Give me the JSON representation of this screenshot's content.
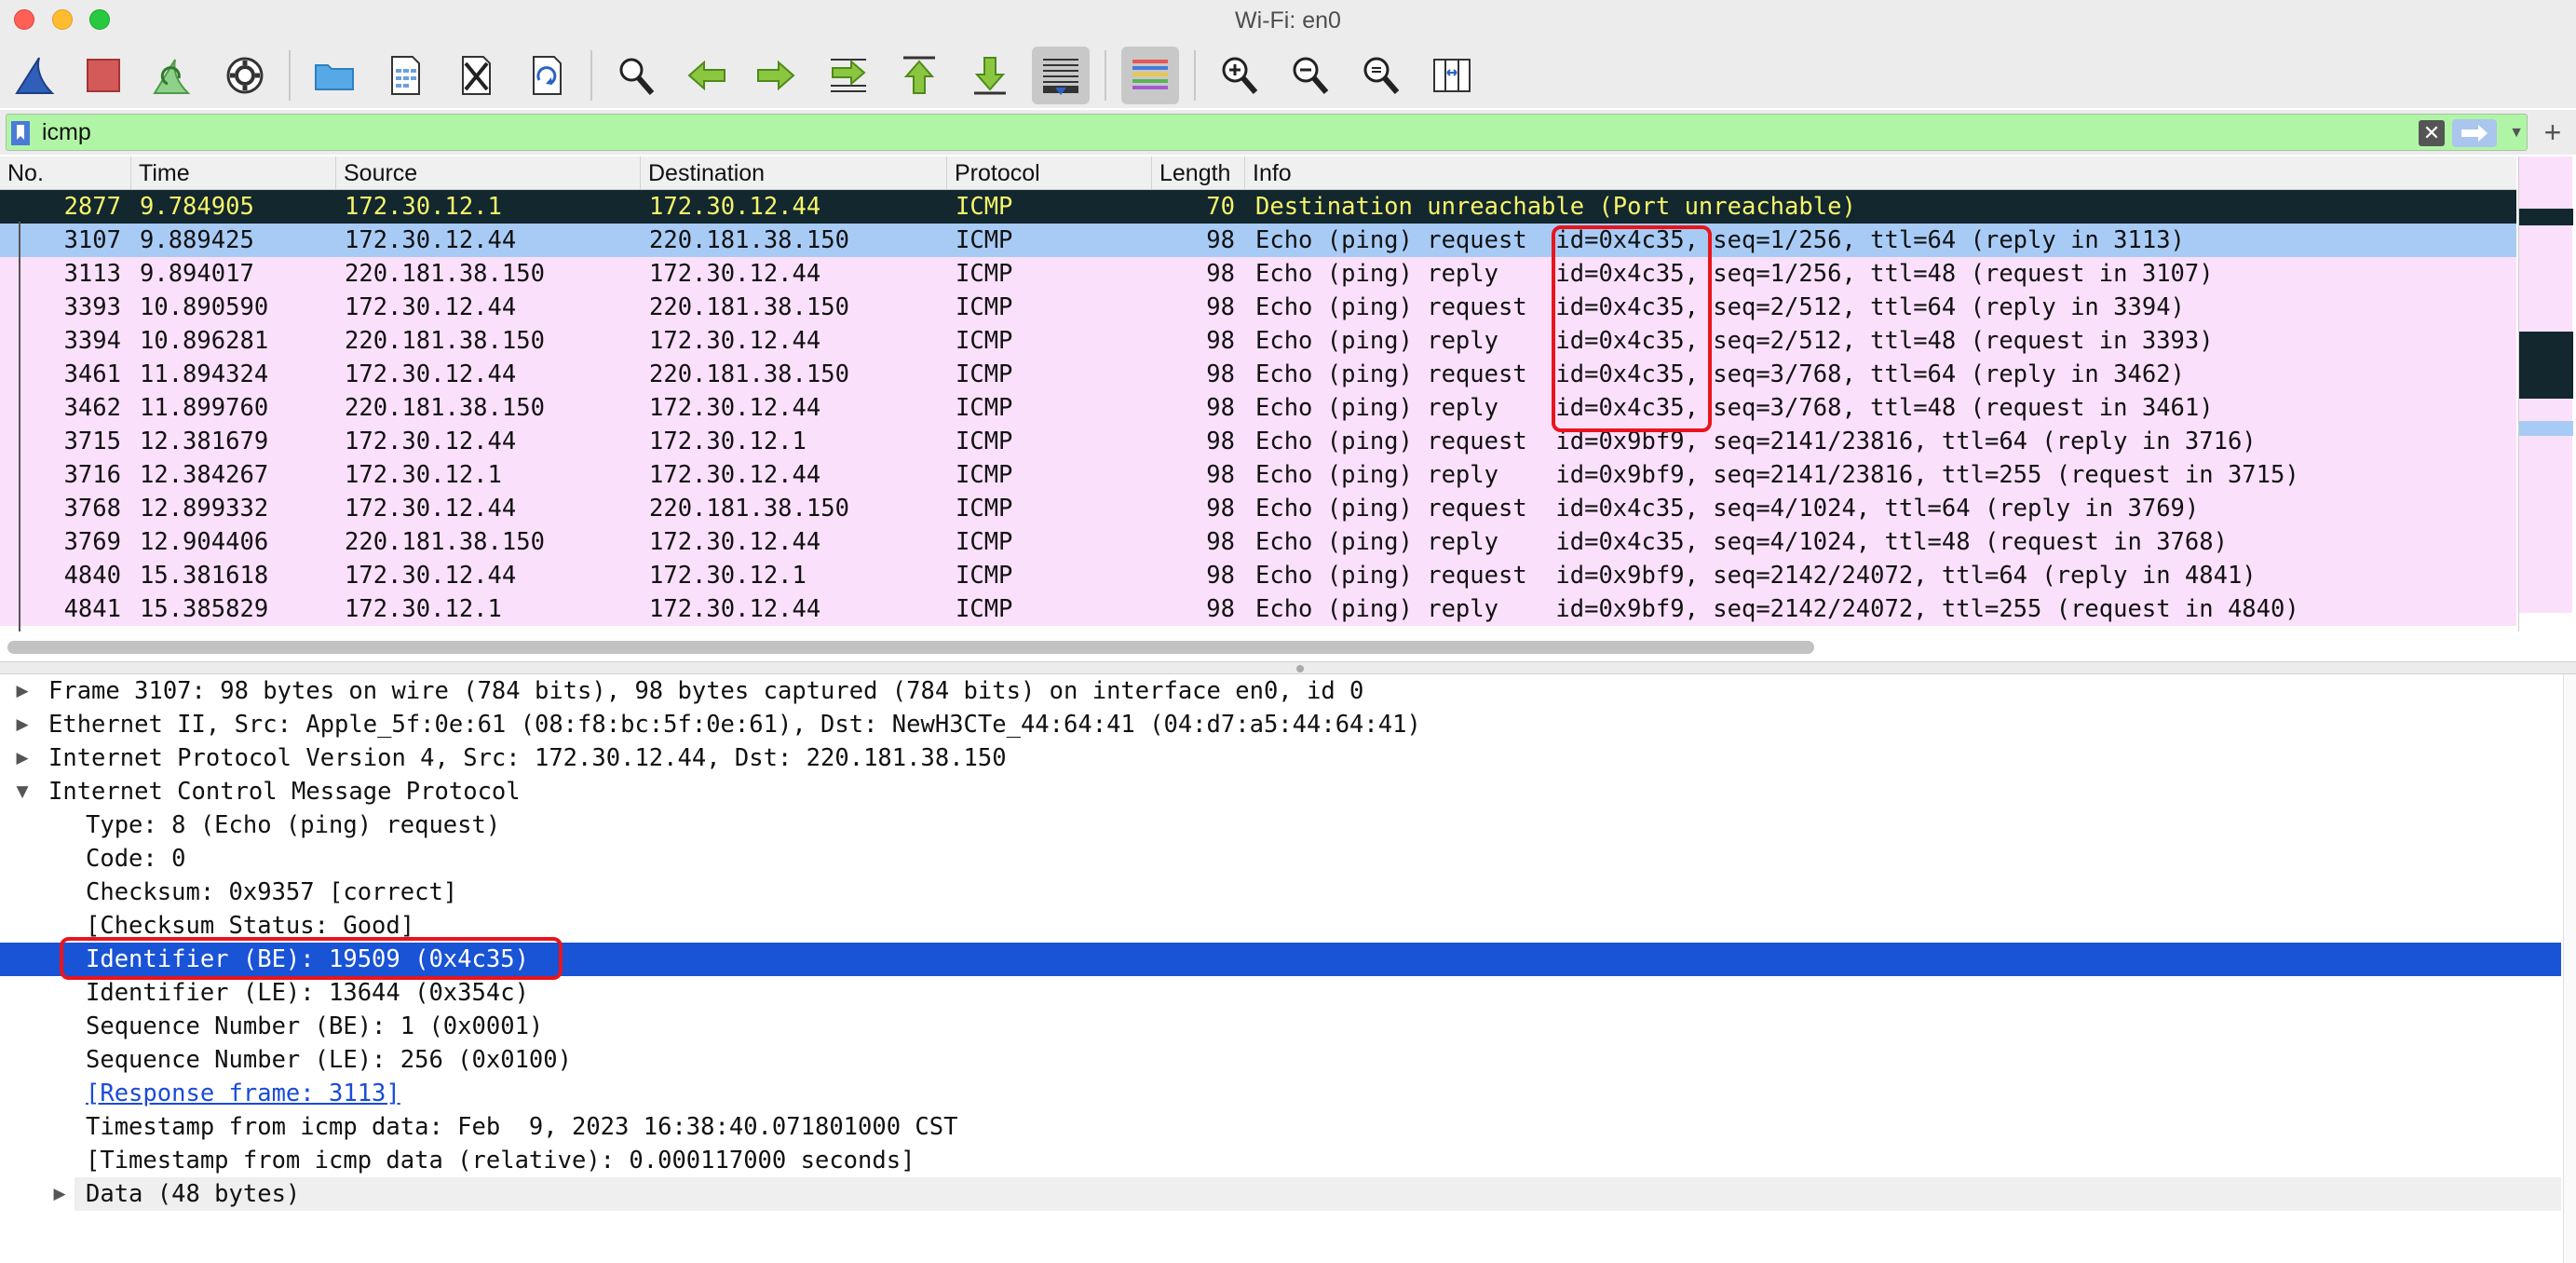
{
  "window": {
    "title": "Wi-Fi: en0"
  },
  "toolbar": {
    "buttons": [
      {
        "name": "start-capture-icon"
      },
      {
        "name": "stop-capture-icon"
      },
      {
        "name": "restart-capture-icon"
      },
      {
        "name": "capture-options-icon"
      },
      {
        "name": "open-file-icon"
      },
      {
        "name": "save-file-icon"
      },
      {
        "name": "close-file-icon"
      },
      {
        "name": "reload-file-icon"
      },
      {
        "name": "find-packet-icon"
      },
      {
        "name": "go-back-icon"
      },
      {
        "name": "go-forward-icon"
      },
      {
        "name": "go-to-packet-icon"
      },
      {
        "name": "go-first-icon"
      },
      {
        "name": "go-last-icon"
      },
      {
        "name": "auto-scroll-icon"
      },
      {
        "name": "colorize-icon"
      },
      {
        "name": "zoom-in-icon"
      },
      {
        "name": "zoom-out-icon"
      },
      {
        "name": "normal-size-icon"
      },
      {
        "name": "resize-columns-icon"
      }
    ]
  },
  "filter": {
    "value": "icmp"
  },
  "packet_list": {
    "columns": [
      "No.",
      "Time",
      "Source",
      "Destination",
      "Protocol",
      "Length",
      "Info"
    ],
    "rows": [
      {
        "no": "2877",
        "time": "9.784905",
        "src": "172.30.12.1",
        "dst": "172.30.12.44",
        "proto": "ICMP",
        "len": "70",
        "info": "Destination unreachable (Port unreachable)"
      },
      {
        "no": "3107",
        "time": "9.889425",
        "src": "172.30.12.44",
        "dst": "220.181.38.150",
        "proto": "ICMP",
        "len": "98",
        "info": "Echo (ping) request  id=0x4c35, seq=1/256, ttl=64 (reply in 3113)"
      },
      {
        "no": "3113",
        "time": "9.894017",
        "src": "220.181.38.150",
        "dst": "172.30.12.44",
        "proto": "ICMP",
        "len": "98",
        "info": "Echo (ping) reply    id=0x4c35, seq=1/256, ttl=48 (request in 3107)"
      },
      {
        "no": "3393",
        "time": "10.890590",
        "src": "172.30.12.44",
        "dst": "220.181.38.150",
        "proto": "ICMP",
        "len": "98",
        "info": "Echo (ping) request  id=0x4c35, seq=2/512, ttl=64 (reply in 3394)"
      },
      {
        "no": "3394",
        "time": "10.896281",
        "src": "220.181.38.150",
        "dst": "172.30.12.44",
        "proto": "ICMP",
        "len": "98",
        "info": "Echo (ping) reply    id=0x4c35, seq=2/512, ttl=48 (request in 3393)"
      },
      {
        "no": "3461",
        "time": "11.894324",
        "src": "172.30.12.44",
        "dst": "220.181.38.150",
        "proto": "ICMP",
        "len": "98",
        "info": "Echo (ping) request  id=0x4c35, seq=3/768, ttl=64 (reply in 3462)"
      },
      {
        "no": "3462",
        "time": "11.899760",
        "src": "220.181.38.150",
        "dst": "172.30.12.44",
        "proto": "ICMP",
        "len": "98",
        "info": "Echo (ping) reply    id=0x4c35, seq=3/768, ttl=48 (request in 3461)"
      },
      {
        "no": "3715",
        "time": "12.381679",
        "src": "172.30.12.44",
        "dst": "172.30.12.1",
        "proto": "ICMP",
        "len": "98",
        "info": "Echo (ping) request  id=0x9bf9, seq=2141/23816, ttl=64 (reply in 3716)"
      },
      {
        "no": "3716",
        "time": "12.384267",
        "src": "172.30.12.1",
        "dst": "172.30.12.44",
        "proto": "ICMP",
        "len": "98",
        "info": "Echo (ping) reply    id=0x9bf9, seq=2141/23816, ttl=255 (request in 3715)"
      },
      {
        "no": "3768",
        "time": "12.899332",
        "src": "172.30.12.44",
        "dst": "220.181.38.150",
        "proto": "ICMP",
        "len": "98",
        "info": "Echo (ping) request  id=0x4c35, seq=4/1024, ttl=64 (reply in 3769)"
      },
      {
        "no": "3769",
        "time": "12.904406",
        "src": "220.181.38.150",
        "dst": "172.30.12.44",
        "proto": "ICMP",
        "len": "98",
        "info": "Echo (ping) reply    id=0x4c35, seq=4/1024, ttl=48 (request in 3768)"
      },
      {
        "no": "4840",
        "time": "15.381618",
        "src": "172.30.12.44",
        "dst": "172.30.12.1",
        "proto": "ICMP",
        "len": "98",
        "info": "Echo (ping) request  id=0x9bf9, seq=2142/24072, ttl=64 (reply in 4841)"
      },
      {
        "no": "4841",
        "time": "15.385829",
        "src": "172.30.12.1",
        "dst": "172.30.12.44",
        "proto": "ICMP",
        "len": "98",
        "info": "Echo (ping) reply    id=0x9bf9, seq=2142/24072, ttl=255 (request in 4840)"
      }
    ]
  },
  "details": {
    "lines": [
      "Frame 3107: 98 bytes on wire (784 bits), 98 bytes captured (784 bits) on interface en0, id 0",
      "Ethernet II, Src: Apple_5f:0e:61 (08:f8:bc:5f:0e:61), Dst: NewH3CTe_44:64:41 (04:d7:a5:44:64:41)",
      "Internet Protocol Version 4, Src: 172.30.12.44, Dst: 220.181.38.150",
      "Internet Control Message Protocol",
      "Type: 8 (Echo (ping) request)",
      "Code: 0",
      "Checksum: 0x9357 [correct]",
      "[Checksum Status: Good]",
      "Identifier (BE): 19509 (0x4c35)",
      "Identifier (LE): 13644 (0x354c)",
      "Sequence Number (BE): 1 (0x0001)",
      "Sequence Number (LE): 256 (0x0100)",
      "[Response frame: 3113]",
      "Timestamp from icmp data: Feb  9, 2023 16:38:40.071801000 CST",
      "[Timestamp from icmp data (relative): 0.000117000 seconds]",
      "Data (48 bytes)"
    ]
  },
  "colors": {
    "icmp_row": "#fbe0fb",
    "error_row_bg": "#12272e",
    "error_row_fg": "#f7f46a",
    "selected_row": "#a8cbf6",
    "selected_detail": "#1953d6",
    "filter_valid": "#b0f5a5",
    "annotation": "#e8151c"
  }
}
